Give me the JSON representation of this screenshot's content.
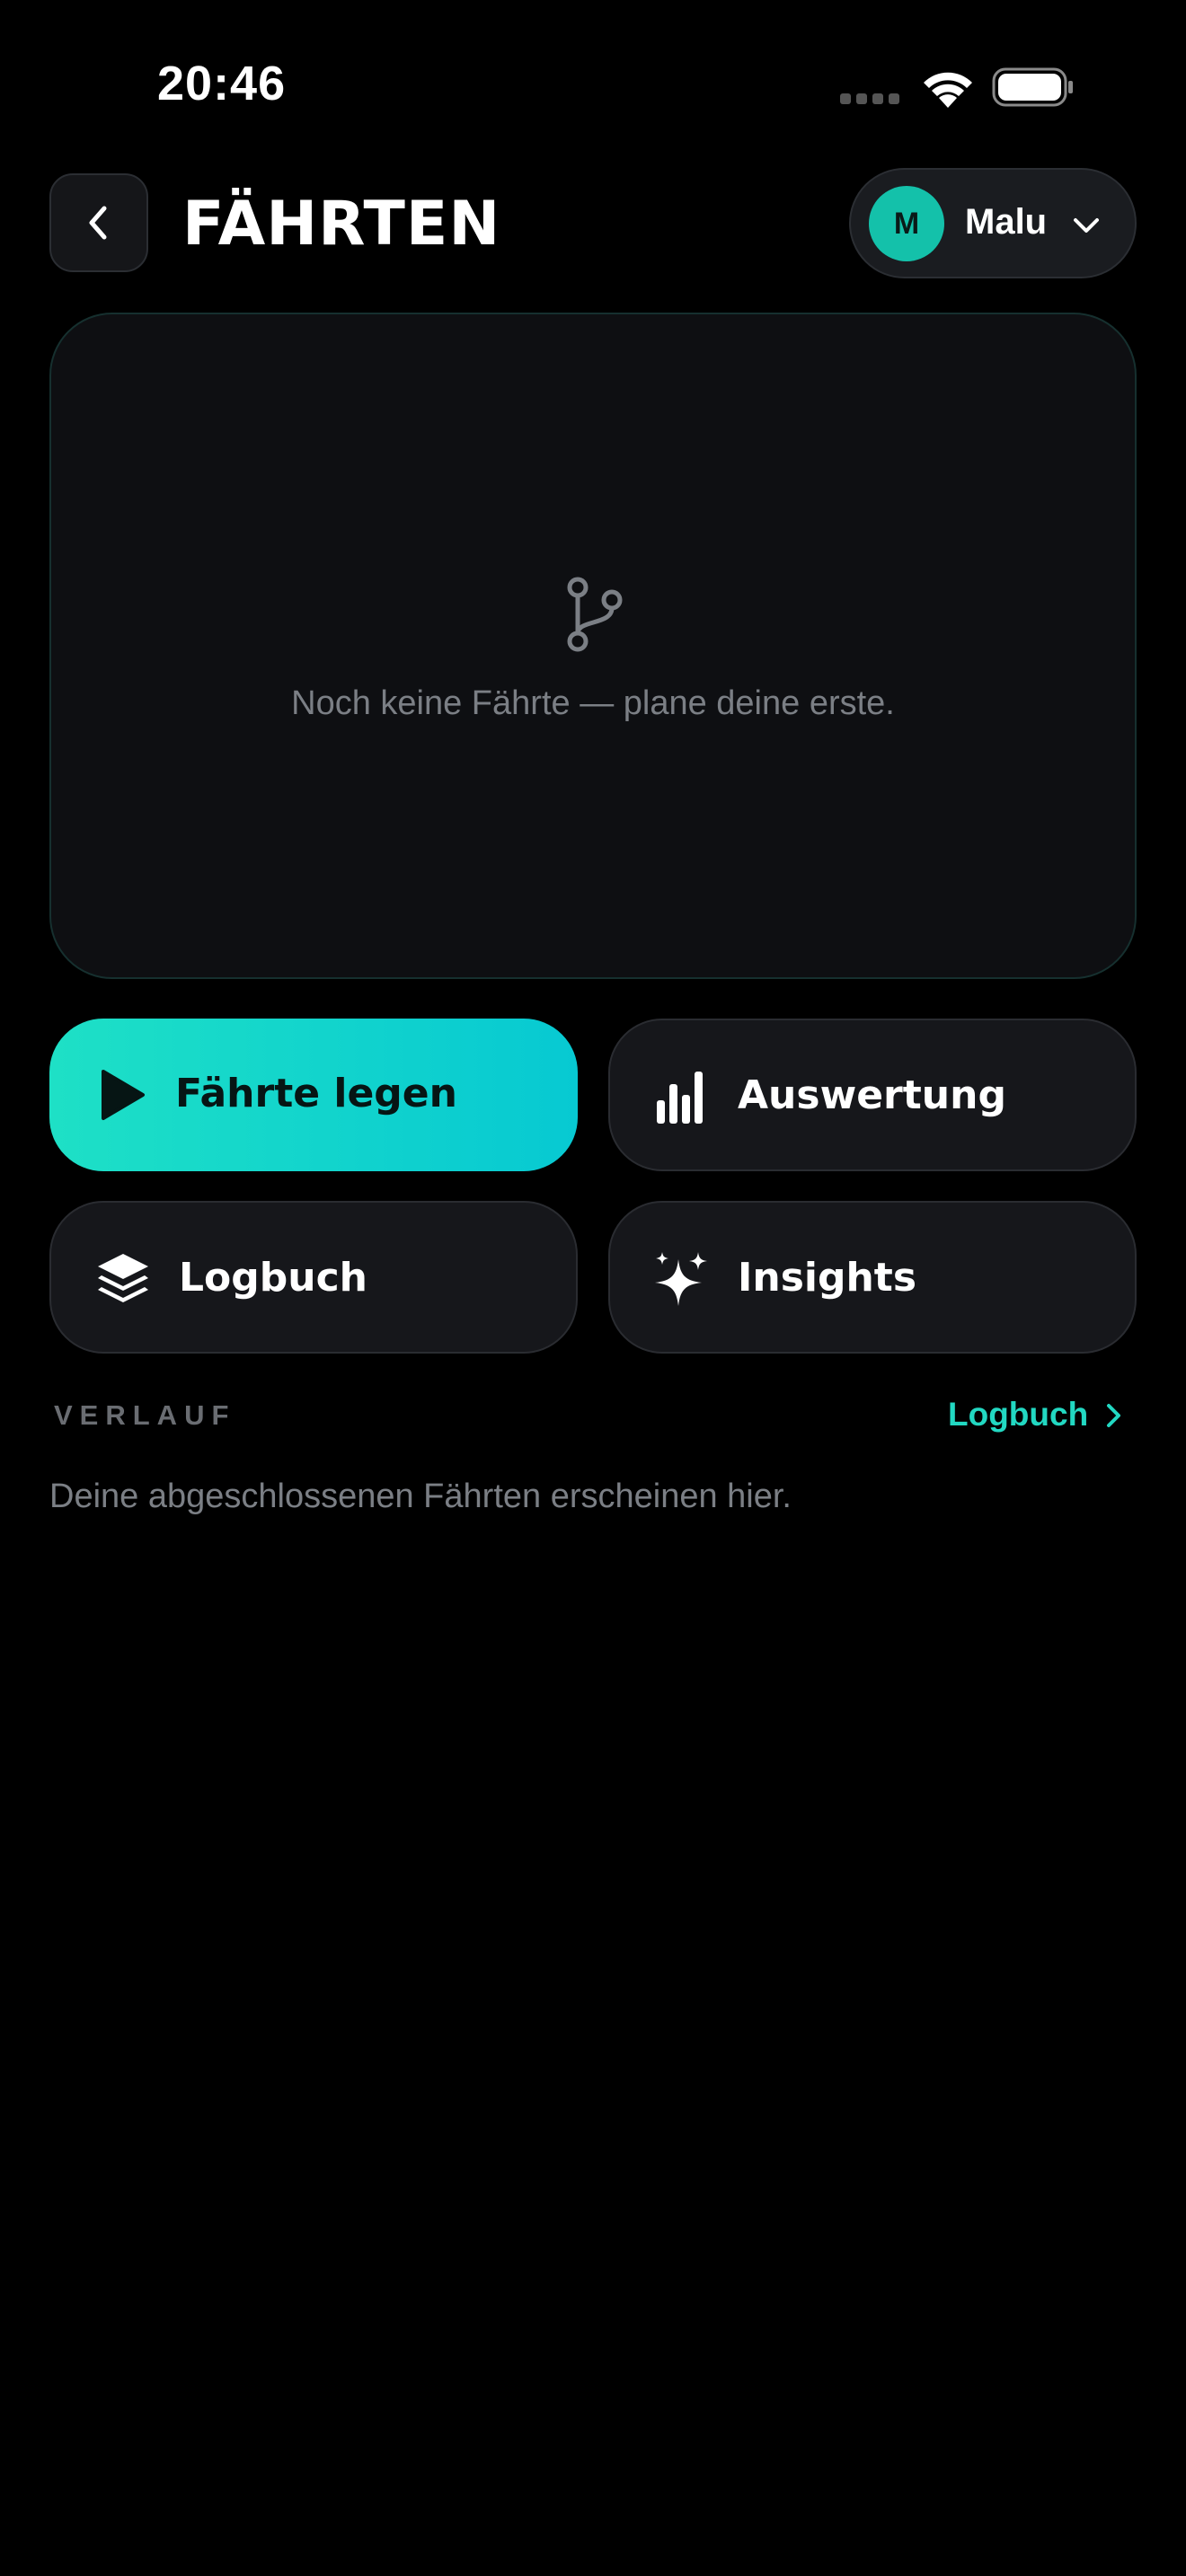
{
  "status_bar": {
    "time": "20:46"
  },
  "header": {
    "title": "FÄHRTEN",
    "profile": {
      "initial": "M",
      "name": "Malu"
    }
  },
  "map_card": {
    "empty_text": "Noch keine Fährte — plane deine erste."
  },
  "actions": [
    {
      "label": "Fährte legen",
      "icon": "play-icon"
    },
    {
      "label": "Auswertung",
      "icon": "bar-chart-icon"
    },
    {
      "label": "Logbuch",
      "icon": "layers-icon"
    },
    {
      "label": "Insights",
      "icon": "sparkles-icon"
    }
  ],
  "history": {
    "section_label": "VERLAUF",
    "link_label": "Logbuch",
    "empty_text": "Deine abgeschlossenen Fährten erscheinen hier."
  },
  "colors": {
    "accent": "#1ee0c6",
    "background": "#000000",
    "card": "#16171b",
    "avatar": "#14c1aa"
  }
}
